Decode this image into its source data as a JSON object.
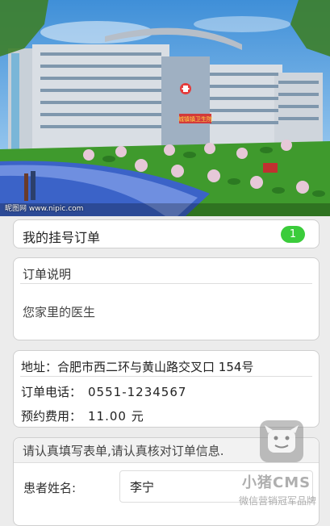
{
  "hero": {
    "sign_text": "城镇镇卫生院",
    "caption": "昵图网 www.nipic.com"
  },
  "orders": {
    "label": "我的挂号订单",
    "count": "1"
  },
  "description": {
    "title": "订单说明",
    "body": "您家里的医生"
  },
  "info": {
    "address": "地址：合肥市西二环与黄山路交叉口 154号",
    "phone_label": "订单电话：",
    "phone": "0551-1234567",
    "fee_label": "预约费用：",
    "fee": "11.00 元"
  },
  "form": {
    "notice": "请认真填写表单,请认真核对订单信息.",
    "name_label": "患者姓名:",
    "name_value": "李宁"
  },
  "watermark": {
    "title": "小猪CMS",
    "subtitle": "微信营销冠军品牌"
  },
  "colors": {
    "badge": "#3bcc3b",
    "sky": "#5aa6e6",
    "lawn": "#3f9a2d"
  }
}
